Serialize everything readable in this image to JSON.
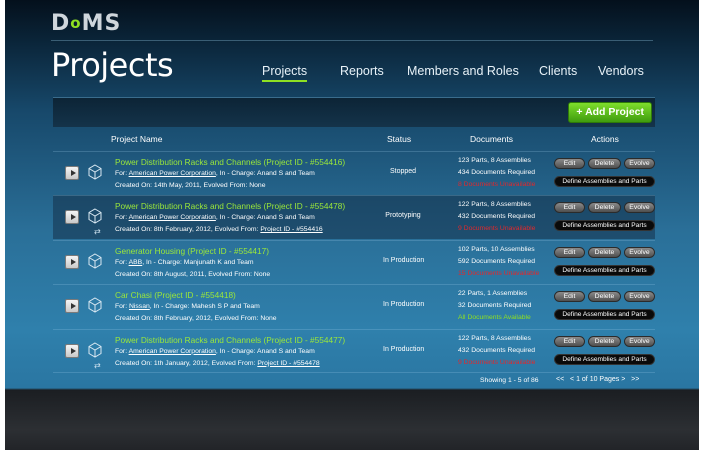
{
  "logo": {
    "text_d": "D",
    "text_o": "o",
    "text_ms": "MS"
  },
  "page_title": "Projects",
  "nav": [
    "Projects",
    "Reports",
    "Members and Roles",
    "Clients",
    "Vendors"
  ],
  "toolbar": {
    "add_label": "+ Add Project"
  },
  "columns": {
    "name": "Project Name",
    "status": "Status",
    "documents": "Documents",
    "actions": "Actions"
  },
  "actions": {
    "edit": "Edit",
    "delete": "Delete",
    "evolve": "Evolve",
    "define": "Define Assemblies and Parts"
  },
  "projects": [
    {
      "title": "Power Distribution Racks and Channels (Project ID - #554416)",
      "for_prefix": "For: ",
      "client": "American Power Corporation",
      "incharge": ", In - Charge: Anand S and Team",
      "created": "Created On: 14th May, 2011,  Evolved From: None",
      "evolved_link": "",
      "status": "Stopped",
      "parts": "123 Parts, 8 Assemblies",
      "required": "434 Documents Required",
      "availability": "8 Documents Unavailable",
      "available": false,
      "evolved": false
    },
    {
      "title": "Power Distribution Racks and Channels (Project ID - #554478)",
      "for_prefix": "For: ",
      "client": "American Power Corporation",
      "incharge": ", In - Charge: Anand S and Team",
      "created": "Created On: 8th February, 2012,  Evolved From: ",
      "evolved_link": "Project ID - #554416",
      "status": "Prototyping",
      "parts": "122 Parts, 8 Assemblies",
      "required": "432 Documents Required",
      "availability": "9 Documents Unavailable",
      "available": false,
      "evolved": true
    },
    {
      "title": "Generator Housing (Project ID - #554417)",
      "for_prefix": "For: ",
      "client": "ABB",
      "incharge": ", In - Charge: Manjunath K and Team",
      "created": "Created On: 8th August, 2011,  Evolved From: None",
      "evolved_link": "",
      "status": "In Production",
      "parts": "102 Parts, 10 Assemblies",
      "required": "592 Documents Required",
      "availability": "15 Documents Unavailable",
      "available": false,
      "evolved": false
    },
    {
      "title": "Car Chasi (Project ID - #554418)",
      "for_prefix": "For: ",
      "client": "Nissan",
      "incharge": ", In - Charge: Mahesh S P and Team",
      "created": "Created On: 8th February, 2012,  Evolved From: None",
      "evolved_link": "",
      "status": "In Production",
      "parts": "22 Parts, 1 Assemblies",
      "required": "32 Documents Required",
      "availability": "All Documents Available",
      "available": true,
      "evolved": false
    },
    {
      "title": "Power Distribution Racks and Channels (Project ID - #554477)",
      "for_prefix": "For: ",
      "client": "American Power Corporation",
      "incharge": ", In - Charge: Anand S and Team",
      "created": "Created On: 1th January, 2012,  Evolved From: ",
      "evolved_link": "Project ID - #554478",
      "status": "In Production",
      "parts": "122 Parts, 8 Assemblies",
      "required": "432 Documents Required",
      "availability": "9 Documents Unavailable",
      "available": false,
      "evolved": true
    }
  ],
  "pagination": {
    "showing": "Showing 1 - 5 of 86",
    "first": "<<",
    "prev": "<",
    "pages": "1 of 10 Pages",
    "next": ">",
    "last": ">>"
  },
  "colors": {
    "accent": "#8ee022",
    "unavailable": "#e2282c",
    "background": "#2a6f98"
  }
}
